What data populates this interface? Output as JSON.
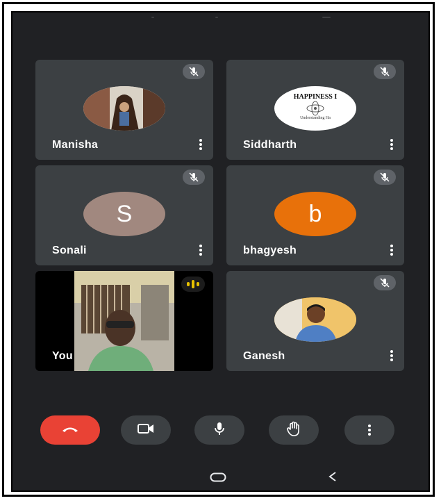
{
  "participants": [
    {
      "name": "Manisha",
      "avatar_type": "photo",
      "muted": true
    },
    {
      "name": "Siddharth",
      "avatar_type": "photo",
      "muted": true,
      "photo_text": [
        "HAPPINESS I",
        "Understanding Ha"
      ]
    },
    {
      "name": "Sonali",
      "avatar_type": "initial",
      "initial": "S",
      "avatar_color": "#a1887f",
      "muted": true
    },
    {
      "name": "bhagyesh",
      "avatar_type": "initial",
      "initial": "b",
      "avatar_color": "#e8710a",
      "muted": true
    },
    {
      "name": "You",
      "avatar_type": "video",
      "speaking": true
    },
    {
      "name": "Ganesh",
      "avatar_type": "photo",
      "muted": true
    }
  ],
  "controls": {
    "end_call": {
      "icon": "phone-hangup-icon",
      "color": "#e94235"
    },
    "camera": {
      "icon": "camera-icon"
    },
    "microphone": {
      "icon": "microphone-icon"
    },
    "raise_hand": {
      "icon": "hand-icon"
    },
    "more_options": {
      "icon": "more-vert-icon"
    }
  },
  "navigation": {
    "home": "home-pill-icon",
    "back": "back-chevron-icon"
  },
  "colors": {
    "background": "#202124",
    "tile": "#3c4043",
    "speaking": "#e8c200"
  }
}
